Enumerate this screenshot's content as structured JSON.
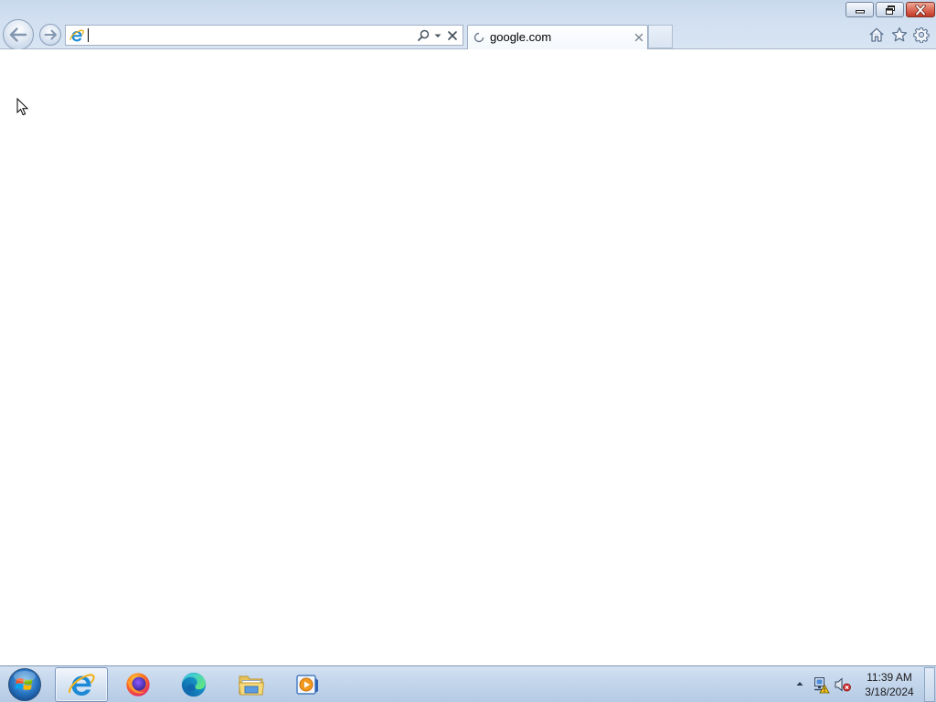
{
  "window_controls": {
    "minimize_icon": "minimize-icon",
    "restore_icon": "restore-icon",
    "close_icon": "close-icon"
  },
  "navigation": {
    "back_icon": "back-arrow-icon",
    "forward_icon": "forward-arrow-icon"
  },
  "address_bar": {
    "value": "",
    "site_icon": "internet-explorer-icon",
    "search_icon": "search-icon",
    "dropdown_icon": "chevron-down-icon",
    "clear_icon": "close-icon"
  },
  "tabs": [
    {
      "title": "google.com",
      "status_icon": "loading-spinner-icon",
      "close_icon": "close-icon",
      "active": true
    }
  ],
  "command_icons": [
    "home-icon",
    "star-icon",
    "gear-icon"
  ],
  "taskbar": {
    "start_icon": "windows-start-orb-icon",
    "items": [
      {
        "icon": "internet-explorer-icon",
        "active": true
      },
      {
        "icon": "firefox-icon",
        "active": false
      },
      {
        "icon": "edge-icon",
        "active": false
      },
      {
        "icon": "file-explorer-icon",
        "active": false
      },
      {
        "icon": "media-player-icon",
        "active": false
      }
    ],
    "tray": {
      "icons": [
        "chevron-up-icon",
        "network-warning-icon",
        "volume-muted-icon"
      ],
      "time": "11:39 AM",
      "date": "3/18/2024"
    }
  },
  "colors": {
    "frame": "#d2e0f1",
    "taskbar": "#c2d5eb",
    "close_button": "#c23823",
    "page_background": "#ffffff",
    "ie_blue": "#1c8ad6"
  }
}
